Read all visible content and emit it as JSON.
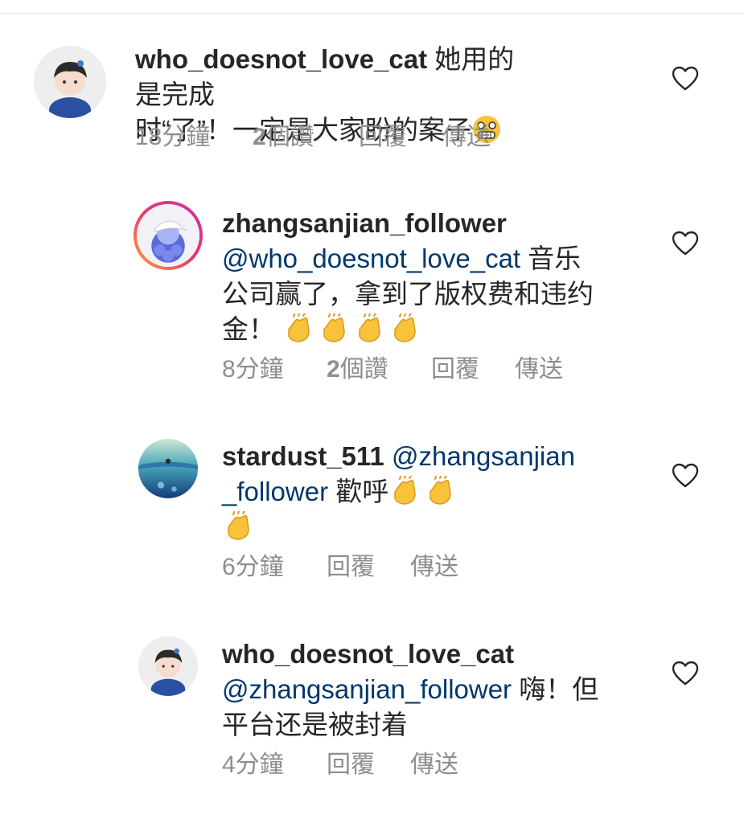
{
  "comments": [
    {
      "username": "who_doesnot_love_cat",
      "text_1": "她用的是完成",
      "text_2": "时“了”！一定是大家盼的案子",
      "time": "18分鐘",
      "likes_num": "2",
      "likes_unit": "個讚",
      "reply": "回覆",
      "send": "傳送"
    },
    {
      "username": "zhangsanjian_follower",
      "mention": "@who_doesnot_love_cat",
      "text_1": "音乐",
      "text_2": "公司赢了，拿到了版权费和违约",
      "text_3": "金！",
      "time": "8分鐘",
      "likes_num": "2",
      "likes_unit": "個讚",
      "reply": "回覆",
      "send": "傳送"
    },
    {
      "username": "stardust_511",
      "mention_1": "@zhangsanjian",
      "mention_2": "_follower",
      "text_1": "歡呼",
      "time": "6分鐘",
      "reply": "回覆",
      "send": "傳送"
    },
    {
      "username": "who_doesnot_love_cat",
      "mention": "@zhangsanjian_follower",
      "text_1": "嗨！但",
      "text_2": "平台还是被封着",
      "time": "4分鐘",
      "reply": "回覆",
      "send": "傳送"
    }
  ],
  "icons": {
    "like": "heart-outline-icon",
    "clap": "clapping-hands-emoji",
    "grimace": "grimacing-face-emoji"
  },
  "colors": {
    "text": "#262626",
    "mention": "#00376b",
    "meta": "#8e8e8e",
    "emoji": "#f8c23a"
  }
}
